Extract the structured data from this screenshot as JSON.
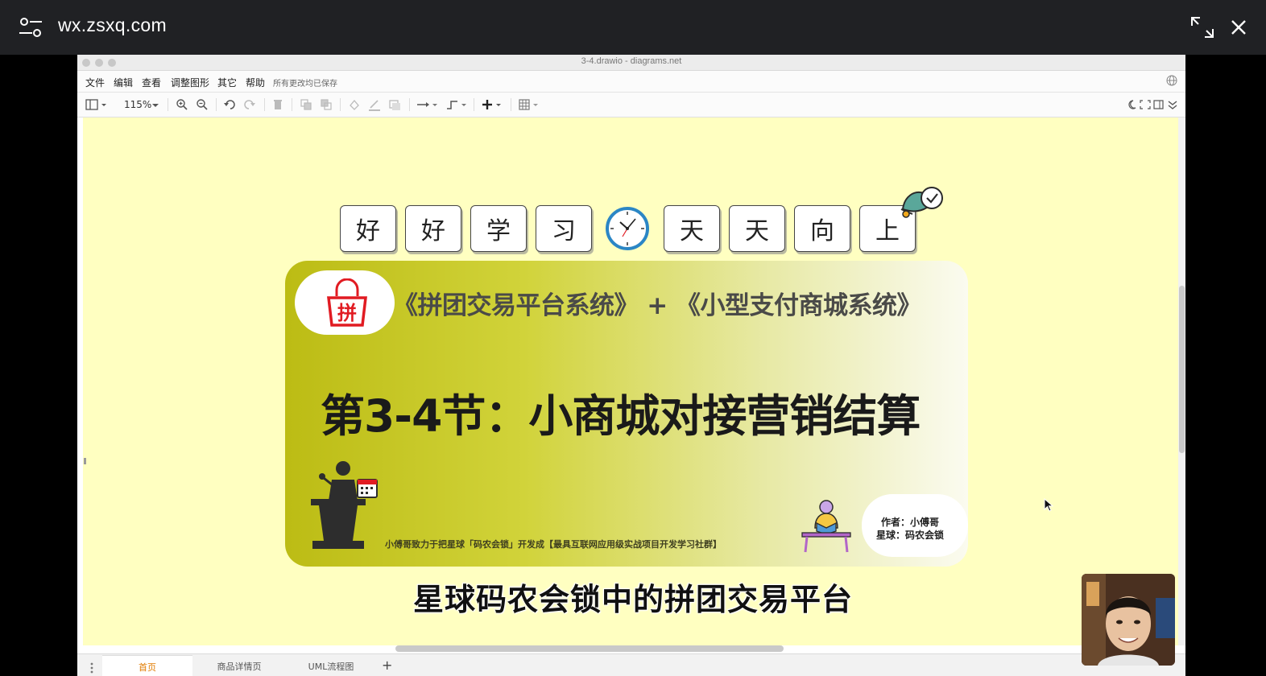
{
  "viewer": {
    "url": "wx.zsxq.com"
  },
  "window": {
    "title": "3-4.drawio - diagrams.net"
  },
  "menu": {
    "items": [
      "文件",
      "编辑",
      "查看",
      "调整图形",
      "其它",
      "帮助"
    ],
    "status": "所有更改均已保存"
  },
  "toolbar": {
    "zoom": "115%"
  },
  "canvas": {
    "tiles_left": [
      "好",
      "好",
      "学",
      "习"
    ],
    "tiles_right": [
      "天",
      "天",
      "向",
      "上"
    ],
    "banner": {
      "logo_char": "拼",
      "subtitle": "《拼团交易平台系统》 + 《小型支付商城系统》",
      "title": "第3-4节：小商城对接营销结算",
      "slogan": "小傅哥致力于把星球「码农会锁」开发成【最具互联网应用级实战项目开发学习社群】",
      "author_line1": "作者：小傅哥",
      "author_line2": "星球：码农会锁"
    },
    "background_color": "#ffffc1"
  },
  "tabs": [
    {
      "label": "首页",
      "active": true
    },
    {
      "label": "商品详情页",
      "active": false
    },
    {
      "label": "UML流程图",
      "active": false
    }
  ],
  "caption": "星球码农会锁中的拼团交易平台",
  "colors": {
    "accent": "#e07b00",
    "clock": "#2b86c5",
    "logo_red": "#e11b22"
  }
}
